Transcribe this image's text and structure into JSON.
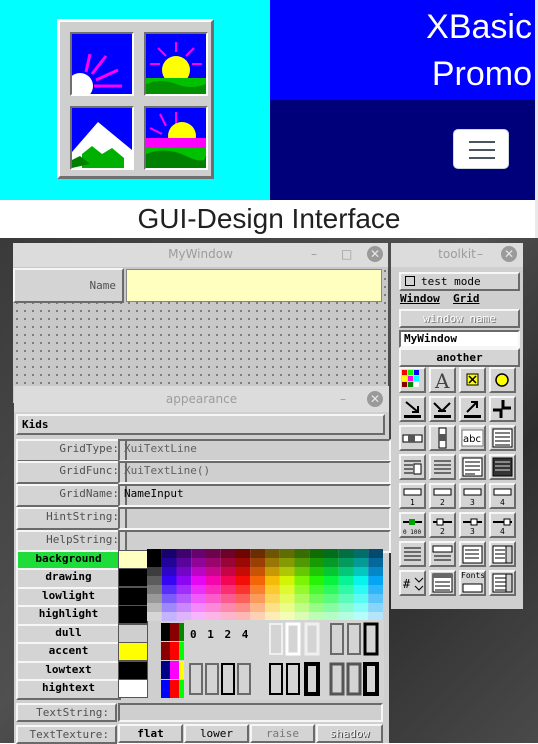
{
  "header": {
    "brand_title": "XBasic\nPromo",
    "subtitle": "GUI-Design Interface",
    "colors": {
      "left_bg": "#00ffff",
      "right_top_bg": "#0000ff",
      "right_bottom_bg": "#00007a"
    },
    "logo_icon": "xbasic-window-logo",
    "menu_icon": "hamburger-icon"
  },
  "mywindow": {
    "title": "MyWindow",
    "minimize": "–",
    "maximize": "□",
    "close": "✕",
    "field_label": "Name",
    "field_value": ""
  },
  "appearance": {
    "title": "appearance",
    "minimize": "–",
    "close": "✕",
    "kids_label": "Kids",
    "rows": [
      {
        "label": "GridType:",
        "value": "XuiTextLine"
      },
      {
        "label": "GridFunc:",
        "value": "XuiTextLine()"
      },
      {
        "label": "GridName:",
        "value": "NameInput"
      },
      {
        "label": "HintString:",
        "value": ""
      },
      {
        "label": "HelpString:",
        "value": ""
      }
    ],
    "color_rows": [
      {
        "label": "background",
        "swatch": "#ffffc0",
        "active": true
      },
      {
        "label": "drawing",
        "swatch": "#000000",
        "active": false
      },
      {
        "label": "lowlight",
        "swatch": "#000000",
        "active": false
      },
      {
        "label": "highlight",
        "swatch": "#000000",
        "active": false
      },
      {
        "label": "dull",
        "swatch": "#cfcfcf",
        "active": false
      },
      {
        "label": "accent",
        "swatch": "#ffff00",
        "active": false
      },
      {
        "label": "lowtext",
        "swatch": "#000000",
        "active": false
      },
      {
        "label": "hightext",
        "swatch": "#ffffff",
        "active": false
      }
    ],
    "border_numbers": "0 1 2 4",
    "text_string_label": "TextString:",
    "text_texture_label": "TextTexture:",
    "texture_buttons": [
      "flat",
      "lower",
      "raise",
      "shadow"
    ]
  },
  "toolkit": {
    "title": "toolkit",
    "minimize": "–",
    "close": "✕",
    "test_mode": "test mode",
    "window_label": "Window",
    "grid_label": "Grid",
    "window_name_label": "window name",
    "window_name_value": "MyWindow",
    "another_label": "another",
    "tool_icons": [
      "color-palette-icon",
      "text-tool-icon",
      "checkbox-tool-icon",
      "radio-tool-icon",
      "push-down-icon",
      "push-down-arrows-icon",
      "push-up-icon",
      "resize-corner-icon",
      "horizontal-slider-icon",
      "vertical-slider-icon",
      "abc-label-icon",
      "grid-panel-icon",
      "list-icon",
      "dropdown-icon",
      "text-area-icon",
      "grid-dark-icon",
      "scale-1-icon",
      "scale-2-icon",
      "scale-3-icon",
      "scale-4-icon",
      "range-1-icon",
      "range-2-icon",
      "range-3-icon",
      "range-4-icon",
      "list-button-icon",
      "combo-box-icon",
      "drop-list-icon",
      "spin-list-icon",
      "number-spin-icon",
      "file-list-icon",
      "fonts-icon",
      "color-list-icon"
    ],
    "scale_numbers": [
      "1",
      "2",
      "3",
      "4"
    ],
    "fonts_label": "Fonts"
  }
}
